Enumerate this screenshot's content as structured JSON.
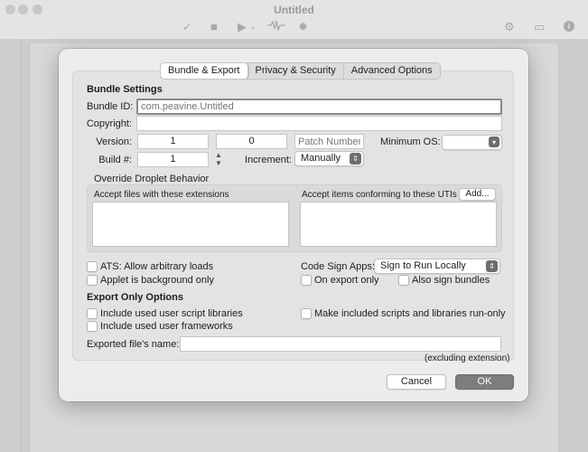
{
  "window": {
    "title": "Untitled",
    "toolbar_icons": [
      "checkmark-icon",
      "stop-icon",
      "play-icon",
      "dropdown-chevron-icon",
      "waveform-icon",
      "bug-icon",
      "gears-icon",
      "briefcase-icon",
      "info-icon"
    ]
  },
  "tabs": [
    {
      "label": "Bundle & Export",
      "active": true
    },
    {
      "label": "Privacy & Security",
      "active": false
    },
    {
      "label": "Advanced Options",
      "active": false
    }
  ],
  "bundle_settings": {
    "heading": "Bundle Settings",
    "bundle_id": {
      "label": "Bundle ID:",
      "value": "",
      "placeholder": "com.peavine.Untitled"
    },
    "copyright": {
      "label": "Copyright:",
      "value": ""
    },
    "version": {
      "label": "Version:",
      "major": "1",
      "minor": "0",
      "patch_placeholder": "Patch Number",
      "separator": "."
    },
    "minimum_os": {
      "label": "Minimum OS:",
      "value": ""
    },
    "build": {
      "label": "Build #:",
      "value": "1"
    },
    "increment": {
      "label": "Increment:",
      "value": "Manually"
    }
  },
  "droplet": {
    "heading": "Override Droplet Behavior",
    "extensions_label": "Accept files with these extensions",
    "utis_label": "Accept items conforming to these UTIs",
    "add_button": "Add..."
  },
  "options": {
    "ats": {
      "label": "ATS: Allow arbitrary loads",
      "checked": false
    },
    "background": {
      "label": "Applet is background only",
      "checked": false
    },
    "code_sign": {
      "label": "Code Sign Apps:",
      "value": "Sign to Run Locally"
    },
    "on_export_only": {
      "label": "On export only",
      "checked": false
    },
    "also_sign_bundles": {
      "label": "Also sign bundles",
      "checked": false
    }
  },
  "export_options": {
    "heading": "Export Only Options",
    "include_libraries": {
      "label": "Include used user script libraries",
      "checked": false
    },
    "include_frameworks": {
      "label": "Include used user frameworks",
      "checked": false
    },
    "run_only": {
      "label": "Make included scripts and libraries run-only",
      "checked": false
    },
    "exported_name": {
      "label": "Exported file's name:",
      "value": "",
      "hint": "(excluding extension)"
    }
  },
  "buttons": {
    "cancel": "Cancel",
    "ok": "OK"
  },
  "colors": {
    "default_button": "#7d7d7d",
    "sheet": "#ececec",
    "panel": "#e3e3e3"
  }
}
